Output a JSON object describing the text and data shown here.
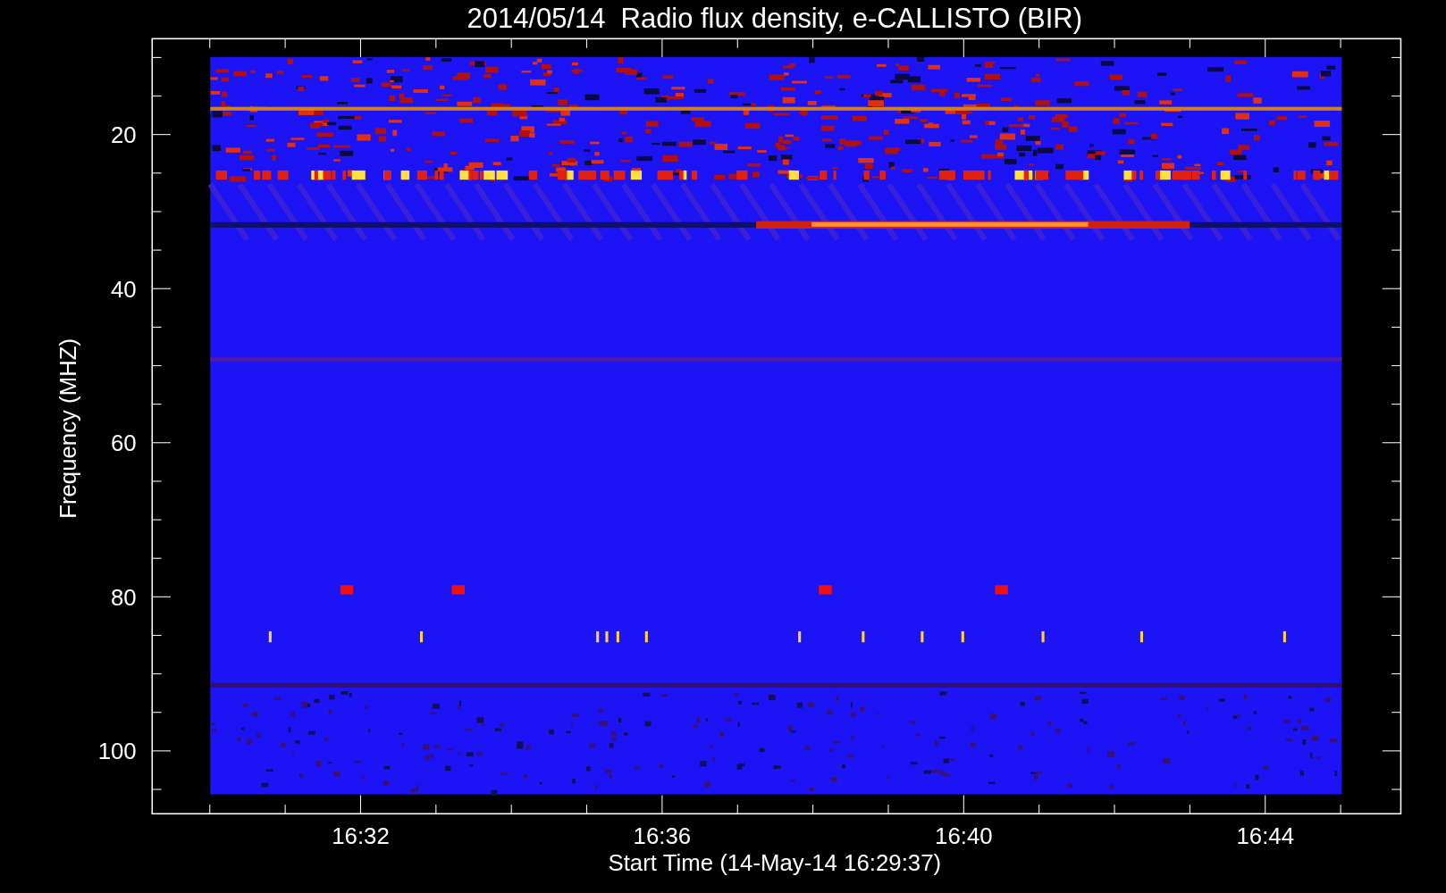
{
  "title": "2014/05/14  Radio flux density, e-CALLISTO (BIR)",
  "y_axis": {
    "label": "Frequency (MHZ)",
    "ticks": [
      "20",
      "40",
      "60",
      "80",
      "100"
    ]
  },
  "x_axis": {
    "label": "Start Time (14-May-14 16:29:37)",
    "ticks": [
      "16:32",
      "16:36",
      "16:40",
      "16:44"
    ]
  }
}
